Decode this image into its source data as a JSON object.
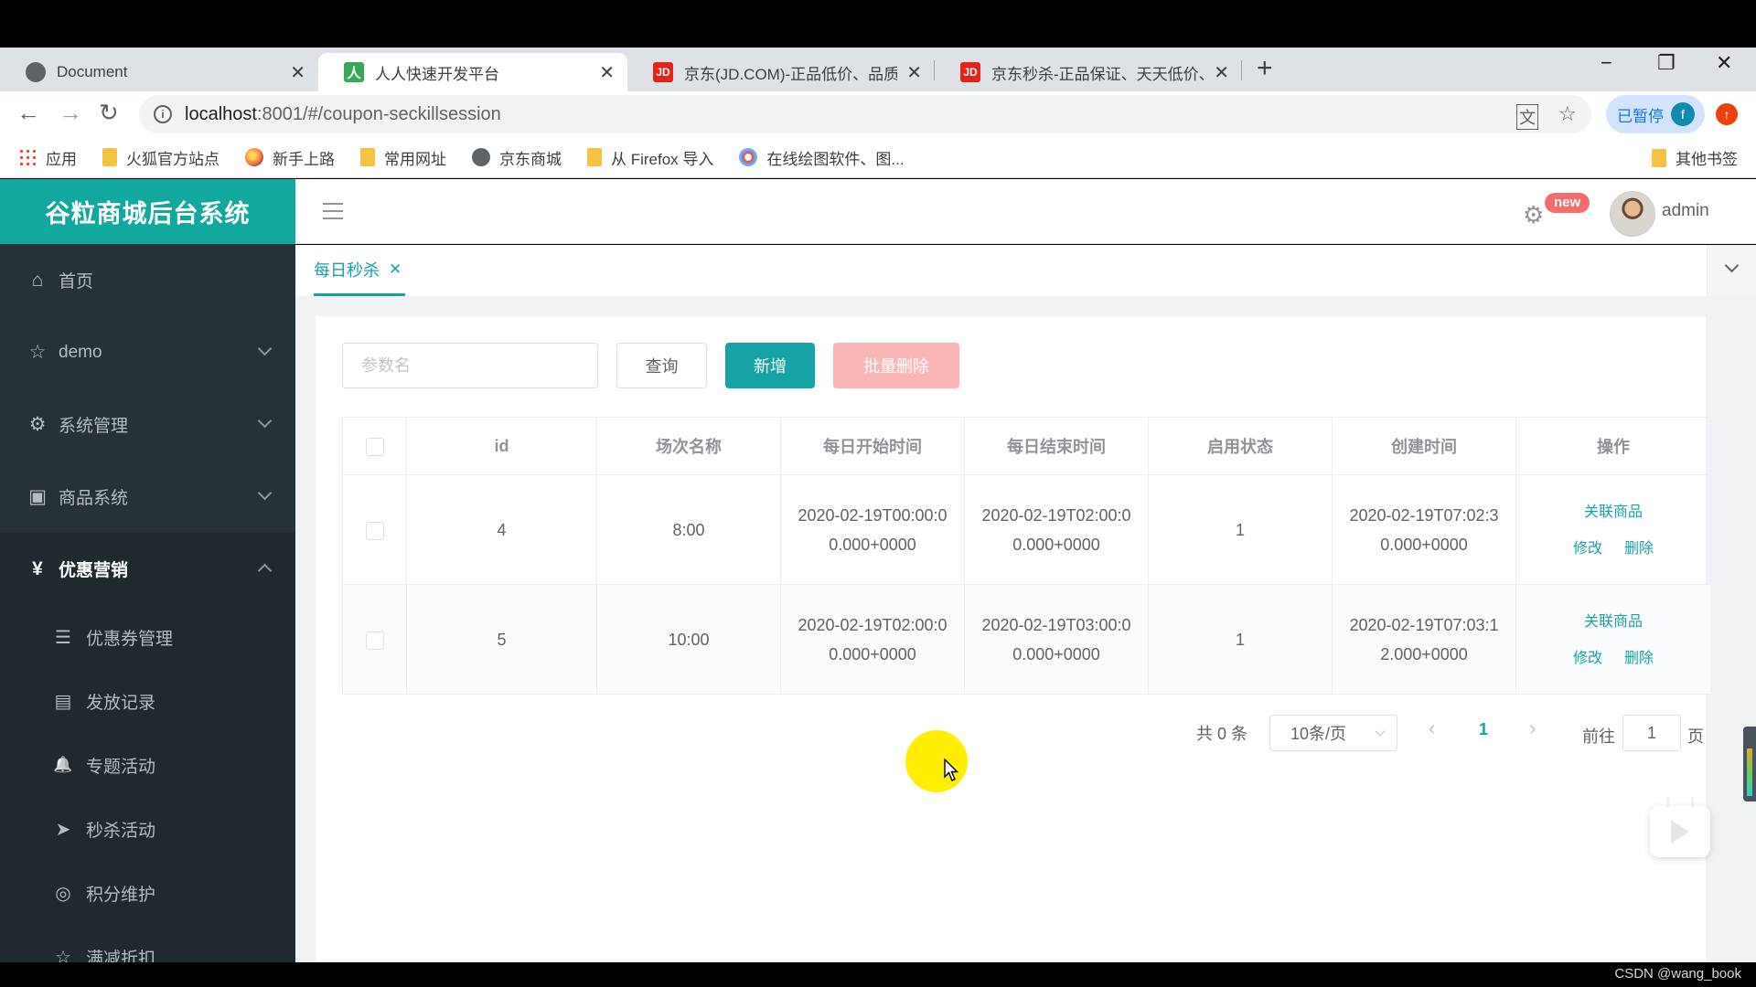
{
  "browser": {
    "tabs": [
      {
        "title": "Document",
        "favicon": "globe-icon",
        "active": false
      },
      {
        "title": "人人快速开发平台",
        "favicon": "renren-icon",
        "favicon_text": "人",
        "active": true
      },
      {
        "title": "京东(JD.COM)-正品低价、品质保",
        "favicon": "jd-icon",
        "favicon_text": "JD",
        "active": false
      },
      {
        "title": "京东秒杀-正品保证、天天低价、",
        "favicon": "jd-icon",
        "favicon_text": "JD",
        "active": false
      }
    ],
    "close_glyph": "✕",
    "new_tab_glyph": "+",
    "window_controls": {
      "minimize": "−",
      "restore": "❐",
      "close": "✕"
    },
    "nav": {
      "back": "←",
      "forward": "→",
      "reload": "↻"
    },
    "url_host": "localhost",
    "url_rest": ":8001/#/coupon-seckillsession",
    "info_glyph": "i",
    "translate_glyph": "文",
    "star_glyph": "☆",
    "profile_label": "已暂停",
    "profile_initial": "f",
    "ext_glyph": "↑",
    "bookmarks": [
      {
        "label": "应用",
        "icon": "apps"
      },
      {
        "label": "火狐官方站点",
        "icon": "folder"
      },
      {
        "label": "新手上路",
        "icon": "firefox"
      },
      {
        "label": "常用网址",
        "icon": "folder"
      },
      {
        "label": "京东商城",
        "icon": "globe2"
      },
      {
        "label": "从 Firefox 导入",
        "icon": "folder"
      },
      {
        "label": "在线绘图软件、图...",
        "icon": "draw"
      }
    ],
    "other_bookmarks": "其他书签"
  },
  "app": {
    "brand": "谷粒商城后台系统",
    "sidebar": {
      "items": [
        {
          "label": "首页",
          "icon": "⌂",
          "expandable": false
        },
        {
          "label": "demo",
          "icon": "☆",
          "expandable": true
        },
        {
          "label": "系统管理",
          "icon": "⚙",
          "expandable": true
        },
        {
          "label": "商品系统",
          "icon": "▣",
          "expandable": true
        },
        {
          "label": "优惠营销",
          "icon": "¥",
          "expandable": true,
          "open": true
        }
      ],
      "sub_items": [
        {
          "label": "优惠券管理",
          "icon": "☰"
        },
        {
          "label": "发放记录",
          "icon": "▤"
        },
        {
          "label": "专题活动",
          "icon": "🔔"
        },
        {
          "label": "秒杀活动",
          "icon": "➤"
        },
        {
          "label": "积分维护",
          "icon": "◎"
        },
        {
          "label": "满减折扣",
          "icon": "☆"
        }
      ]
    },
    "header": {
      "gear_glyph": "⚙",
      "badge": "new",
      "username": "admin"
    },
    "view_tabs": [
      {
        "label": "每日秒杀",
        "close": "✕",
        "active": true
      }
    ],
    "toolbar": {
      "search_placeholder": "参数名",
      "search_value": "",
      "query_label": "查询",
      "add_label": "新增",
      "batch_delete_label": "批量删除"
    },
    "table": {
      "columns": [
        "id",
        "场次名称",
        "每日开始时间",
        "每日结束时间",
        "启用状态",
        "创建时间",
        "操作"
      ],
      "rows": [
        {
          "id": "4",
          "name": "8:00",
          "start": "2020-02-19T00:00:00.000+0000",
          "end": "2020-02-19T02:00:00.000+0000",
          "status": "1",
          "created": "2020-02-19T07:02:30.000+0000"
        },
        {
          "id": "5",
          "name": "10:00",
          "start": "2020-02-19T02:00:00.000+0000",
          "end": "2020-02-19T03:00:00.000+0000",
          "status": "1",
          "created": "2020-02-19T07:03:12.000+0000"
        }
      ],
      "actions": {
        "relate": "关联商品",
        "edit": "修改",
        "delete": "删除"
      }
    },
    "pagination": {
      "total_text": "共 0 条",
      "page_size": "10条/页",
      "prev": "‹",
      "current_page": "1",
      "next": "›",
      "goto_label": "前往",
      "goto_value": "1",
      "page_suffix": "页"
    }
  },
  "watermark": "CSDN @wang_book",
  "colors": {
    "accent": "#17a2a6",
    "danger_light": "#fab6b6",
    "sidebar": "#263238",
    "brand_bar": "#13a89e",
    "badge": "#f56c6c"
  }
}
